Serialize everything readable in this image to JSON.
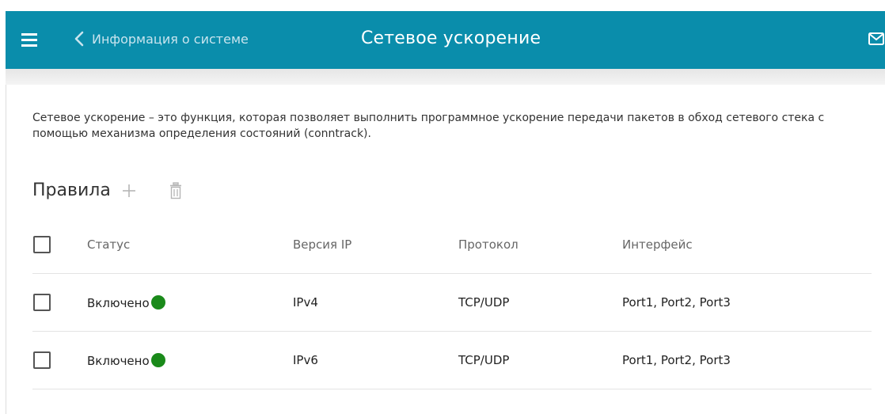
{
  "header": {
    "back_label": "Информация о системе",
    "title": "Сетевое ускорение",
    "icons": {
      "menu": "hamburger-menu-icon",
      "back": "chevron-left-icon",
      "mail": "mail-icon"
    },
    "background_color": "#0a8dab"
  },
  "main": {
    "description": "Сетевое ускорение – это функция, которая позволяет выполнить программное ускорение передачи пакетов в обход сетевого стека с помощью механизма определения состояний (conntrack).",
    "rules": {
      "title": "Правила",
      "icons": {
        "add": "plus-icon",
        "delete": "trash-icon"
      },
      "columns": [
        "Статус",
        "Версия IP",
        "Протокол",
        "Интерфейс"
      ],
      "rows": [
        {
          "status": "Включено",
          "ip_version": "IPv4",
          "protocol": "TCP/UDP",
          "interface": "Port1, Port2, Port3"
        },
        {
          "status": "Включено",
          "ip_version": "IPv6",
          "protocol": "TCP/UDP",
          "interface": "Port1, Port2, Port3"
        }
      ],
      "status_color": "#1a8a1a"
    }
  }
}
